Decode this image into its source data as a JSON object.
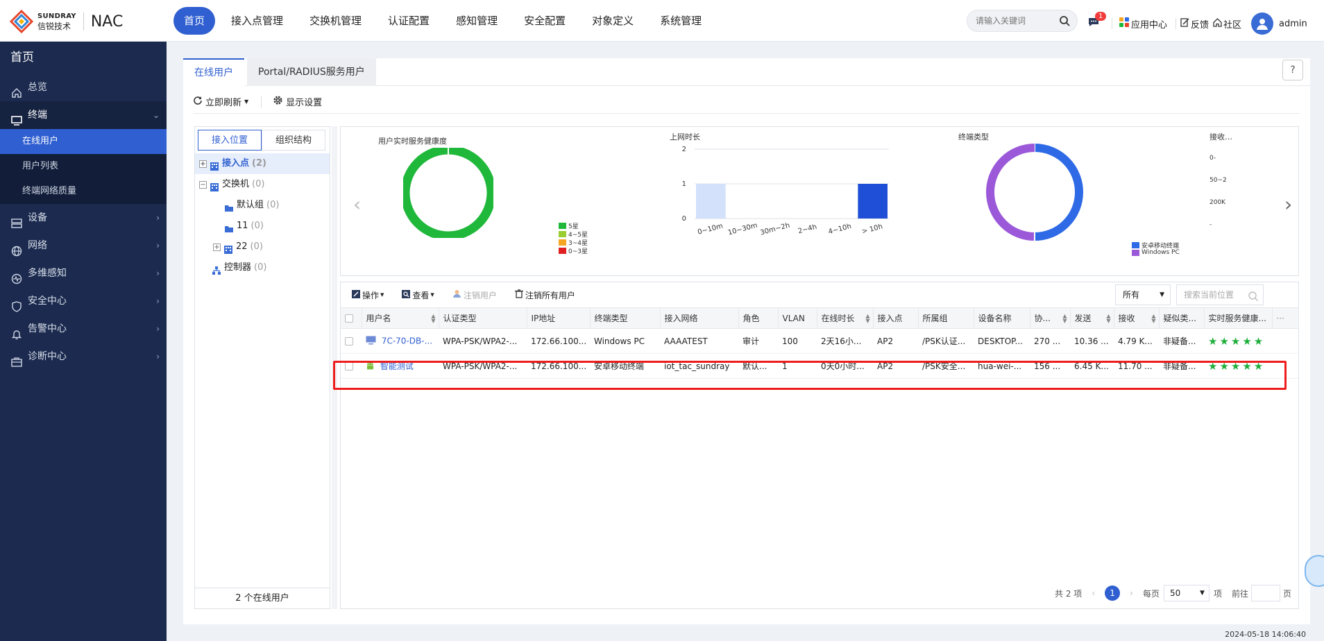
{
  "app": {
    "brand_en": "SUNDRAY",
    "brand_cn": "信锐技术",
    "product": "NAC"
  },
  "nav": [
    "首页",
    "接入点管理",
    "交换机管理",
    "认证配置",
    "感知管理",
    "安全配置",
    "对象定义",
    "系统管理"
  ],
  "header": {
    "search_placeholder": "请输入关键词",
    "msg_badge": "1",
    "app_center": "应用中心",
    "feedback": "反馈",
    "community": "社区",
    "user": "admin"
  },
  "sidebar": {
    "home": "首页",
    "items": [
      {
        "label": "总览",
        "icon": "home-icon"
      },
      {
        "label": "终端",
        "icon": "monitor-icon"
      },
      {
        "label": "设备",
        "icon": "server-icon"
      },
      {
        "label": "网络",
        "icon": "globe-icon"
      },
      {
        "label": "多维感知",
        "icon": "pulse-icon"
      },
      {
        "label": "安全中心",
        "icon": "shield-icon"
      },
      {
        "label": "告警中心",
        "icon": "bell-icon"
      },
      {
        "label": "诊断中心",
        "icon": "toolbox-icon"
      }
    ],
    "sub_items": [
      "在线用户",
      "用户列表",
      "终端网络质量"
    ]
  },
  "tabs": [
    "在线用户",
    "Portal/RADIUS服务用户"
  ],
  "toolbar": {
    "refresh": "立即刷新",
    "display": "显示设置"
  },
  "tree": {
    "tabs": [
      "接入位置",
      "组织结构"
    ],
    "nodes": [
      {
        "label": "接入点",
        "count": "(2)"
      },
      {
        "label": "交换机",
        "count": "(0)"
      },
      {
        "label": "默认组",
        "count": "(0)"
      },
      {
        "label": "11",
        "count": "(0)"
      },
      {
        "label": "22",
        "count": "(0)"
      },
      {
        "label": "控制器",
        "count": "(0)"
      }
    ],
    "footer": "2 个在线用户"
  },
  "chart_data": [
    {
      "type": "pie",
      "title": "用户实时服务健康度",
      "labels": [
        "5星",
        "4~5星",
        "3~4星",
        "0~3星"
      ],
      "values": [
        2,
        0,
        0,
        0
      ],
      "colors": [
        "#1fb83a",
        "#9acd32",
        "#f5a623",
        "#e02020"
      ]
    },
    {
      "type": "bar",
      "title": "上网时长",
      "categories": [
        "0~10m",
        "10~30m",
        "30m~2h",
        "2~4h",
        "4~10h",
        "> 10h"
      ],
      "values": [
        1,
        0,
        0,
        0,
        0,
        1
      ],
      "ylim": [
        0,
        2
      ],
      "yticks": [
        "0",
        "1",
        "2"
      ],
      "colors": [
        "#d3e1fb",
        "#1f4fd6"
      ]
    },
    {
      "type": "pie",
      "title": "终端类型",
      "labels": [
        "安卓移动终端",
        "Windows PC"
      ],
      "values": [
        1,
        1
      ],
      "colors": [
        "#2e6ae6",
        "#9b59d9"
      ]
    },
    {
      "type": "bar",
      "title": "接收…",
      "yticks": [
        "0-",
        "50~2",
        "200K",
        "-"
      ]
    }
  ],
  "table_toolbar": {
    "operate": "操作",
    "view": "查看",
    "logout_user": "注销用户",
    "logout_all": "注销所有用户",
    "filter": "所有",
    "search_placeholder": "搜索当前位置"
  },
  "columns": [
    "用户名",
    "认证类型",
    "IP地址",
    "终端类型",
    "接入网络",
    "角色",
    "VLAN",
    "在线时长",
    "接入点",
    "所属组",
    "设备名称",
    "协...",
    "发送",
    "接收",
    "疑似类...",
    "实时服务健康..."
  ],
  "rows": [
    {
      "user": "7C-70-DB-...",
      "auth": "WPA-PSK/WPA2-...",
      "ip": "172.66.100...",
      "type": "Windows PC",
      "ssid": "AAAATEST",
      "role": "审计",
      "vlan": "100",
      "online": "2天16小...",
      "ap": "AP2",
      "group": "/PSK认证...",
      "device": "DESKTOP...",
      "proto": "270 ...",
      "send": "10.36 ...",
      "recv": "4.79 K...",
      "susp": "非疑备...",
      "icon": "monitor-icon"
    },
    {
      "user": "智能测试",
      "auth": "WPA-PSK/WPA2-...",
      "ip": "172.66.100...",
      "type": "安卓移动终端",
      "ssid": "iot_tac_sundray",
      "role": "默认...",
      "vlan": "1",
      "online": "0天0小时...",
      "ap": "AP2",
      "group": "/PSK安全...",
      "device": "hua-wei-...",
      "proto": "156 ...",
      "send": "6.45 K...",
      "recv": "11.70 ...",
      "susp": "非疑备...",
      "icon": "android-icon"
    }
  ],
  "pager": {
    "total": "共 2 项",
    "current": "1",
    "per_page_label": "每页",
    "per_page": "50",
    "items": "项",
    "goto": "前往",
    "page": "页"
  },
  "timestamp": "2024-05-18 14:06:40"
}
